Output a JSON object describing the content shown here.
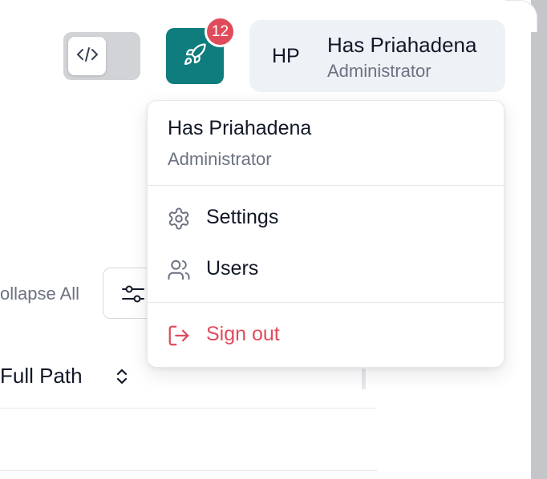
{
  "header": {
    "code_toggle": {
      "icon": "code-icon"
    },
    "launch": {
      "icon": "rocket-icon",
      "badge_count": "12",
      "accent": "#0f7c7d",
      "badge_color": "#e04b5b"
    },
    "user": {
      "initials": "HP",
      "name": "Has Priahadena",
      "role": "Administrator"
    }
  },
  "toolbar": {
    "collapse_all_label": "ollapse All",
    "filter_icon": "sliders-icon"
  },
  "table": {
    "columns": [
      {
        "label": "Full Path",
        "sort_icon": "sort-updown-icon"
      }
    ]
  },
  "user_menu": {
    "name": "Has Priahadena",
    "role": "Administrator",
    "items": [
      {
        "label": "Settings",
        "icon": "gear-icon"
      },
      {
        "label": "Users",
        "icon": "users-icon"
      }
    ],
    "sign_out": {
      "label": "Sign out",
      "icon": "sign-out-icon",
      "color": "#e04b5b"
    }
  }
}
